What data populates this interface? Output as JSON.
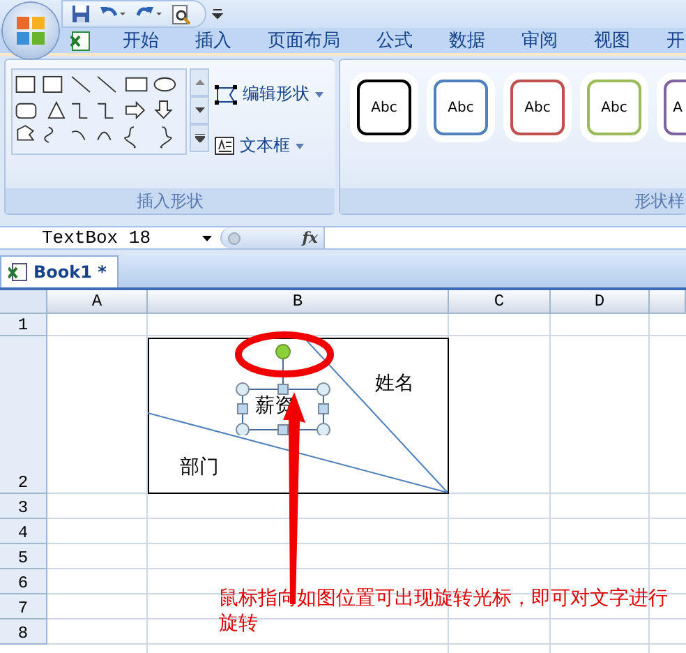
{
  "tabs": [
    {
      "label": "开始"
    },
    {
      "label": "插入"
    },
    {
      "label": "页面布局"
    },
    {
      "label": "公式"
    },
    {
      "label": "数据"
    },
    {
      "label": "审阅"
    },
    {
      "label": "视图"
    },
    {
      "label": "开"
    }
  ],
  "ribbon": {
    "edit_shape_button": "编辑形状",
    "text_box_button": "文本框",
    "group_labels": [
      "插入形状",
      "形状样"
    ]
  },
  "shape_styles": [
    {
      "label": "Abc",
      "color": "#000000"
    },
    {
      "label": "Abc",
      "color": "#4f81bd"
    },
    {
      "label": "Abc",
      "color": "#c0504d"
    },
    {
      "label": "Abc",
      "color": "#9bbb59"
    },
    {
      "label": "A",
      "color": "#8064a2"
    }
  ],
  "formula_bar": {
    "name_box": "TextBox 18",
    "fx": "fx"
  },
  "workbook_tab": "Book1 *",
  "columns": [
    "A",
    "B",
    "C",
    "D"
  ],
  "rows": [
    "1",
    "2",
    "3",
    "4",
    "5",
    "6",
    "7",
    "8"
  ],
  "diagram": {
    "top_right_label": "姓名",
    "bottom_left_label": "部门",
    "selected_text_box": "薪资"
  },
  "annotation": "鼠标指向如图位置可出现旋转光标，即可对文字进行旋转"
}
